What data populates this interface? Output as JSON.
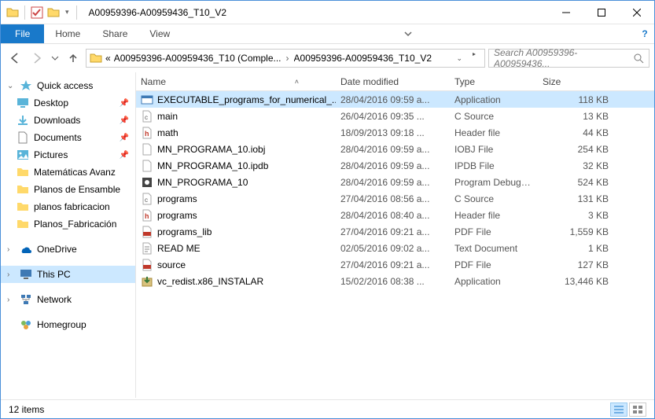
{
  "window": {
    "title": "A00959396-A00959436_T10_V2"
  },
  "ribbon": {
    "file": "File",
    "home": "Home",
    "share": "Share",
    "view": "View"
  },
  "address": {
    "prefix": "«",
    "seg1": "A00959396-A00959436_T10 (Comple...",
    "seg2": "A00959396-A00959436_T10_V2"
  },
  "search": {
    "placeholder": "Search A00959396-A00959436..."
  },
  "columns": {
    "name": "Name",
    "date": "Date modified",
    "type": "Type",
    "size": "Size"
  },
  "nav": {
    "quick": "Quick access",
    "desktop": "Desktop",
    "downloads": "Downloads",
    "documents": "Documents",
    "pictures": "Pictures",
    "mat": "Matemáticas Avanz",
    "planosE": "Planos de Ensamble",
    "planosf": "planos fabricacion",
    "planosF": "Planos_Fabricación",
    "onedrive": "OneDrive",
    "thispc": "This PC",
    "network": "Network",
    "homegroup": "Homegroup"
  },
  "files": [
    {
      "name": "EXECUTABLE_programs_for_numerical_...",
      "date": "28/04/2016 09:59 a...",
      "type": "Application",
      "size": "118 KB",
      "icon": "app",
      "selected": true
    },
    {
      "name": "main",
      "date": "26/04/2016 09:35 ...",
      "type": "C Source",
      "size": "13 KB",
      "icon": "c"
    },
    {
      "name": "math",
      "date": "18/09/2013 09:18 ...",
      "type": "Header file",
      "size": "44 KB",
      "icon": "h"
    },
    {
      "name": "MN_PROGRAMA_10.iobj",
      "date": "28/04/2016 09:59 a...",
      "type": "IOBJ File",
      "size": "254 KB",
      "icon": "blank"
    },
    {
      "name": "MN_PROGRAMA_10.ipdb",
      "date": "28/04/2016 09:59 a...",
      "type": "IPDB File",
      "size": "32 KB",
      "icon": "blank"
    },
    {
      "name": "MN_PROGRAMA_10",
      "date": "28/04/2016 09:59 a...",
      "type": "Program Debug D...",
      "size": "524 KB",
      "icon": "pdb"
    },
    {
      "name": "programs",
      "date": "27/04/2016 08:56 a...",
      "type": "C Source",
      "size": "131 KB",
      "icon": "c"
    },
    {
      "name": "programs",
      "date": "28/04/2016 08:40 a...",
      "type": "Header file",
      "size": "3 KB",
      "icon": "h"
    },
    {
      "name": "programs_lib",
      "date": "27/04/2016 09:21 a...",
      "type": "PDF File",
      "size": "1,559 KB",
      "icon": "pdf"
    },
    {
      "name": "READ ME",
      "date": "02/05/2016 09:02 a...",
      "type": "Text Document",
      "size": "1 KB",
      "icon": "txt"
    },
    {
      "name": "source",
      "date": "27/04/2016 09:21 a...",
      "type": "PDF File",
      "size": "127 KB",
      "icon": "pdf"
    },
    {
      "name": "vc_redist.x86_INSTALAR",
      "date": "15/02/2016 08:38 ...",
      "type": "Application",
      "size": "13,446 KB",
      "icon": "installer"
    }
  ],
  "status": {
    "count": "12 items"
  }
}
